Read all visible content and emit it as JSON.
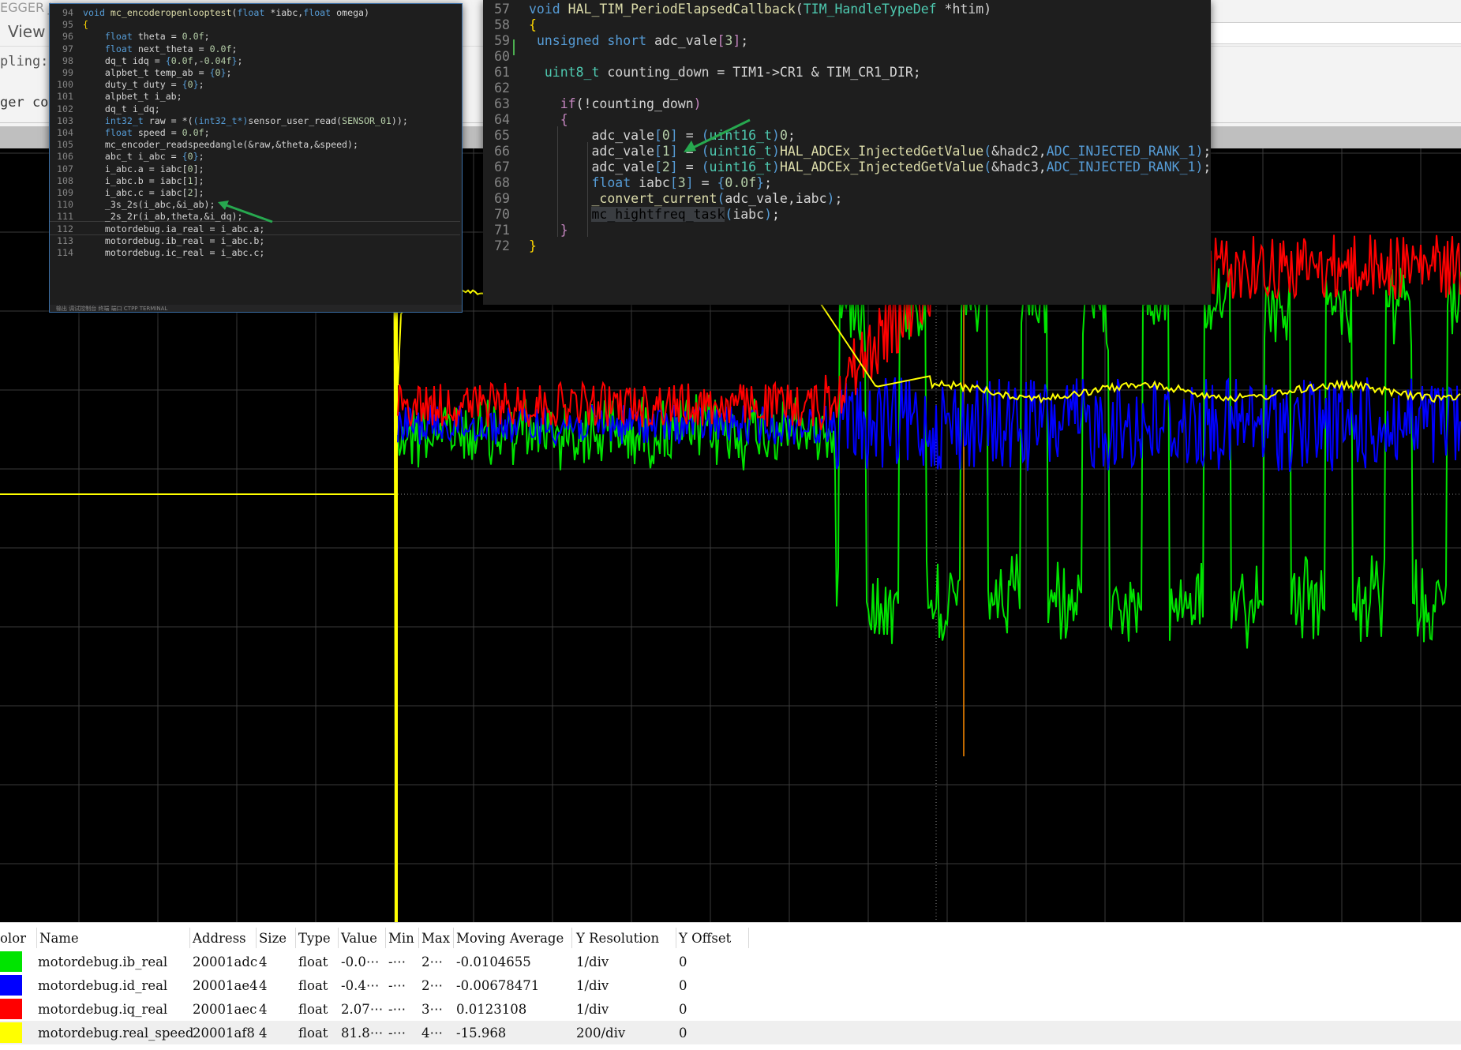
{
  "chrome": {
    "title_fragment": "EGGER J",
    "view_label": "View",
    "sampling_fragment": "pling:",
    "trigger_fragment": "ger con"
  },
  "code_left": {
    "footer": "输出   调试控制台   终端   端口   CTPP TERMINAL",
    "lines": [
      {
        "n": "94",
        "t": [
          [
            "kw",
            "void "
          ],
          [
            "fn",
            "mc_encoderopenlooptest"
          ],
          [
            "tx",
            "("
          ],
          [
            "kw",
            "float "
          ],
          [
            "tx",
            "*iabc,"
          ],
          [
            "kw",
            "float "
          ],
          [
            "tx",
            "omega)"
          ]
        ]
      },
      {
        "n": "95",
        "t": [
          [
            "br",
            "{"
          ]
        ]
      },
      {
        "n": "96",
        "t": [
          [
            "tx",
            "    "
          ],
          [
            "kw",
            "float "
          ],
          [
            "tx",
            "theta = "
          ],
          [
            "num",
            "0.0f"
          ],
          [
            "tx",
            ";"
          ]
        ]
      },
      {
        "n": "97",
        "t": [
          [
            "tx",
            "    "
          ],
          [
            "kw",
            "float "
          ],
          [
            "tx",
            "next_theta = "
          ],
          [
            "num",
            "0.0f"
          ],
          [
            "tx",
            ";"
          ]
        ]
      },
      {
        "n": "98",
        "t": [
          [
            "tx",
            "    dq_t idq = "
          ],
          [
            "kw",
            "{"
          ],
          [
            "num",
            "0.0f"
          ],
          [
            "tx",
            ",-"
          ],
          [
            "num",
            "0.04f"
          ],
          [
            "kw",
            "}"
          ],
          [
            "tx",
            ";"
          ]
        ]
      },
      {
        "n": "99",
        "t": [
          [
            "tx",
            "    alpbet_t temp_ab = "
          ],
          [
            "kw",
            "{"
          ],
          [
            "num",
            "0"
          ],
          [
            "kw",
            "}"
          ],
          [
            "tx",
            ";"
          ]
        ]
      },
      {
        "n": "100",
        "t": [
          [
            "tx",
            "    duty_t duty = "
          ],
          [
            "kw",
            "{"
          ],
          [
            "num",
            "0"
          ],
          [
            "kw",
            "}"
          ],
          [
            "tx",
            ";"
          ]
        ]
      },
      {
        "n": "101",
        "t": [
          [
            "tx",
            "    alpbet_t i_ab;"
          ]
        ]
      },
      {
        "n": "102",
        "t": [
          [
            "tx",
            "    dq_t i_dq;"
          ]
        ]
      },
      {
        "n": "103",
        "t": [
          [
            "tx",
            "    "
          ],
          [
            "kw",
            "int32_t "
          ],
          [
            "tx",
            "raw = *("
          ],
          [
            "kw",
            "(int32_t*)"
          ],
          [
            "tx",
            "sensor_user_read("
          ],
          [
            "num",
            "SENSOR_01"
          ],
          [
            "tx",
            "));"
          ]
        ]
      },
      {
        "n": "104",
        "t": [
          [
            "tx",
            "    "
          ],
          [
            "kw",
            "float "
          ],
          [
            "tx",
            "speed = "
          ],
          [
            "num",
            "0.0f"
          ],
          [
            "tx",
            ";"
          ]
        ]
      },
      {
        "n": "105",
        "t": [
          [
            "tx",
            "    mc_encoder_readspeedangle(&raw,&theta,&speed);"
          ]
        ]
      },
      {
        "n": "106",
        "t": [
          [
            "tx",
            "    abc_t i_abc = "
          ],
          [
            "kw",
            "{"
          ],
          [
            "num",
            "0"
          ],
          [
            "kw",
            "}"
          ],
          [
            "tx",
            ";"
          ]
        ]
      },
      {
        "n": "107",
        "t": [
          [
            "tx",
            "    i_abc.a = iabc["
          ],
          [
            "num",
            "0"
          ],
          [
            "tx",
            "];"
          ]
        ]
      },
      {
        "n": "108",
        "t": [
          [
            "tx",
            "    i_abc.b = iabc["
          ],
          [
            "num",
            "1"
          ],
          [
            "tx",
            "];"
          ]
        ]
      },
      {
        "n": "109",
        "t": [
          [
            "tx",
            "    i_abc.c = iabc["
          ],
          [
            "num",
            "2"
          ],
          [
            "tx",
            "];"
          ]
        ]
      },
      {
        "n": "110",
        "t": [
          [
            "tx",
            "    _3s_2s(i_abc,&i_ab);"
          ]
        ]
      },
      {
        "n": "111",
        "t": [
          [
            "tx",
            "    _2s_2r(i_ab,theta,&i_dq);"
          ]
        ]
      },
      {
        "n": "112",
        "t": [
          [
            "tx",
            "    motordebug.ia_real = i_abc.a;"
          ]
        ]
      },
      {
        "n": "113",
        "t": [
          [
            "tx",
            "    motordebug.ib_real = i_abc.b;"
          ]
        ]
      },
      {
        "n": "114",
        "t": [
          [
            "tx",
            "    motordebug.ic_real = i_abc.c;"
          ]
        ]
      }
    ]
  },
  "code_right": {
    "lines": [
      {
        "n": "57",
        "t": [
          [
            "kw",
            "void "
          ],
          [
            "fn",
            "HAL_TIM_PeriodElapsedCallback"
          ],
          [
            "tx",
            "("
          ],
          [
            "ty",
            "TIM_HandleTypeDef"
          ],
          [
            "tx",
            " *htim)"
          ]
        ]
      },
      {
        "n": "58",
        "t": [
          [
            "br",
            "{"
          ]
        ]
      },
      {
        "n": "59",
        "t": [
          [
            "tx",
            " "
          ],
          [
            "kw",
            "unsigned short "
          ],
          [
            "tx",
            "adc_vale"
          ],
          [
            "ct",
            "["
          ],
          [
            "num",
            "3"
          ],
          [
            "ct",
            "]"
          ],
          [
            "tx",
            ";"
          ]
        ]
      },
      {
        "n": "60",
        "t": [
          [
            "tx",
            ""
          ]
        ]
      },
      {
        "n": "61",
        "t": [
          [
            "tx",
            "  "
          ],
          [
            "ty",
            "uint8_t "
          ],
          [
            "tx",
            "counting_down = TIM1->CR1 & TIM_CR1_DIR;"
          ]
        ]
      },
      {
        "n": "62",
        "t": [
          [
            "tx",
            ""
          ]
        ]
      },
      {
        "n": "63",
        "t": [
          [
            "tx",
            "    "
          ],
          [
            "ct",
            "if"
          ],
          [
            "tx",
            "(!counting_down"
          ],
          [
            "ct",
            ")"
          ]
        ]
      },
      {
        "n": "64",
        "t": [
          [
            "tx",
            "    "
          ],
          [
            "ct",
            "{"
          ]
        ]
      },
      {
        "n": "65",
        "t": [
          [
            "tx",
            "        adc_vale"
          ],
          [
            "kw",
            "["
          ],
          [
            "num",
            "0"
          ],
          [
            "kw",
            "]"
          ],
          [
            "tx",
            " = "
          ],
          [
            "kw",
            "("
          ],
          [
            "ty",
            "uint16_t"
          ],
          [
            "kw",
            ")"
          ],
          [
            "num",
            "0"
          ],
          [
            "tx",
            ";"
          ]
        ]
      },
      {
        "n": "66",
        "t": [
          [
            "tx",
            "        adc_vale"
          ],
          [
            "kw",
            "["
          ],
          [
            "num",
            "1"
          ],
          [
            "kw",
            "]"
          ],
          [
            "tx",
            " = "
          ],
          [
            "kw",
            "("
          ],
          [
            "ty",
            "uint16_t"
          ],
          [
            "kw",
            ")"
          ],
          [
            "fn",
            "HAL_ADCEx_InjectedGetValue"
          ],
          [
            "kw",
            "("
          ],
          [
            "tx",
            "&hadc2,"
          ],
          [
            "kw",
            "ADC_INJECTED_RANK_1"
          ],
          [
            "kw",
            ")"
          ],
          [
            "tx",
            ";"
          ]
        ]
      },
      {
        "n": "67",
        "t": [
          [
            "tx",
            "        adc_vale"
          ],
          [
            "kw",
            "["
          ],
          [
            "num",
            "2"
          ],
          [
            "kw",
            "]"
          ],
          [
            "tx",
            " = "
          ],
          [
            "kw",
            "("
          ],
          [
            "ty",
            "uint16_t"
          ],
          [
            "kw",
            ")"
          ],
          [
            "fn",
            "HAL_ADCEx_InjectedGetValue"
          ],
          [
            "kw",
            "("
          ],
          [
            "tx",
            "&hadc3,"
          ],
          [
            "kw",
            "ADC_INJECTED_RANK_1"
          ],
          [
            "kw",
            ")"
          ],
          [
            "tx",
            ";"
          ]
        ]
      },
      {
        "n": "68",
        "t": [
          [
            "tx",
            "        "
          ],
          [
            "kw",
            "float "
          ],
          [
            "tx",
            "iabc"
          ],
          [
            "kw",
            "["
          ],
          [
            "num",
            "3"
          ],
          [
            "kw",
            "]"
          ],
          [
            "tx",
            " = "
          ],
          [
            "kw",
            "{"
          ],
          [
            "num",
            "0.0f"
          ],
          [
            "kw",
            "}"
          ],
          [
            "tx",
            ";"
          ]
        ]
      },
      {
        "n": "69",
        "t": [
          [
            "tx",
            "        "
          ],
          [
            "fn",
            "_convert_current"
          ],
          [
            "kw",
            "("
          ],
          [
            "tx",
            "adc_vale,iabc"
          ],
          [
            "kw",
            ")"
          ],
          [
            "tx",
            ";"
          ]
        ]
      },
      {
        "n": "70",
        "t": [
          [
            "tx",
            "        "
          ],
          [
            "hl",
            "mc_hightfreq_task"
          ],
          [
            "kw",
            "("
          ],
          [
            "tx",
            "iabc"
          ],
          [
            "kw",
            ")"
          ],
          [
            "tx",
            ";"
          ]
        ]
      },
      {
        "n": "71",
        "t": [
          [
            "tx",
            "    "
          ],
          [
            "ct",
            "}"
          ]
        ]
      },
      {
        "n": "72",
        "t": [
          [
            "br",
            "}"
          ]
        ]
      }
    ]
  },
  "table": {
    "headers": [
      "olor",
      "Name",
      "Address",
      "Size",
      "Type",
      "Value",
      "Min",
      "Max",
      "Moving Average",
      "Y Resolution",
      "Y Offset"
    ],
    "rows": [
      {
        "color": "#00e400",
        "name": "motordebug.ib_real",
        "address": "20001adc",
        "size": "4",
        "type": "float",
        "value": "-0.0⋯",
        "min": "-⋯",
        "max": "2⋯",
        "avg": "-0.0104655",
        "res": "1/div",
        "offset": "0"
      },
      {
        "color": "#0000ff",
        "name": "motordebug.id_real",
        "address": "20001ae4",
        "size": "4",
        "type": "float",
        "value": "-0.4⋯",
        "min": "-⋯",
        "max": "2⋯",
        "avg": "-0.00678471",
        "res": "1/div",
        "offset": "0"
      },
      {
        "color": "#ff0000",
        "name": "motordebug.iq_real",
        "address": "20001aec",
        "size": "4",
        "type": "float",
        "value": "2.07⋯",
        "min": "-⋯",
        "max": "3⋯",
        "avg": "0.0123108",
        "res": "1/div",
        "offset": "0"
      },
      {
        "color": "#ffff00",
        "name": "motordebug.real_speed",
        "address": "20001af8",
        "size": "4",
        "type": "float",
        "value": "81.8⋯",
        "min": "-⋯",
        "max": "4⋯",
        "avg": "-15.968",
        "res": "200/div",
        "offset": "0"
      }
    ]
  },
  "scope": {
    "background": "#000000",
    "grid_color": "#3a3a3a",
    "trace_colors": {
      "ib": "#00e400",
      "id": "#0000ff",
      "iq": "#ff0000",
      "speed": "#ffff00"
    },
    "cursor_color": "#ff8c00"
  }
}
